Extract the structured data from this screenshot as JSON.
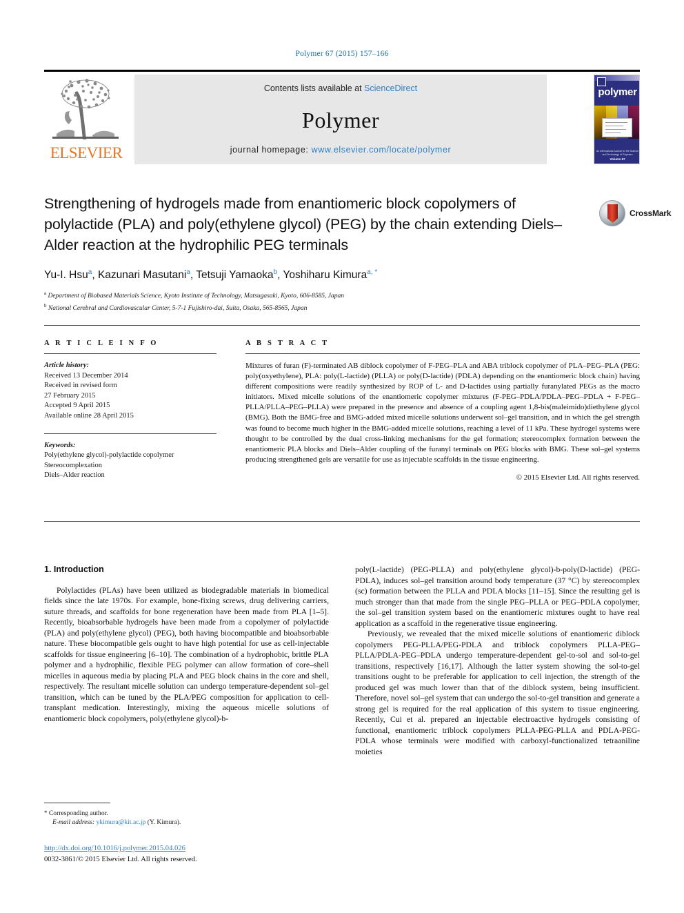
{
  "running_head": "Polymer 67 (2015) 157–166",
  "masthead": {
    "contents_prefix": "Contents lists available at ",
    "sciencedirect": "ScienceDirect",
    "journal_name": "Polymer",
    "homepage_prefix": "journal homepage: ",
    "homepage_url": "www.elsevier.com/locate/polymer",
    "publisher": "ELSEVIER",
    "cover_title": "polymer",
    "cover_footer_small": "An International Journal for the Science and Technology of Polymers",
    "cover_footer_bold": "Volume 67"
  },
  "crossmark": {
    "label": "CrossMark"
  },
  "title": "Strengthening of hydrogels made from enantiomeric block copolymers of polylactide (PLA) and poly(ethylene glycol) (PEG) by the chain extending Diels–Alder reaction at the hydrophilic PEG terminals",
  "authors": [
    {
      "name": "Yu-I. Hsu",
      "sup": "a"
    },
    {
      "name": "Kazunari Masutani",
      "sup": "a"
    },
    {
      "name": "Tetsuji Yamaoka",
      "sup": "b"
    },
    {
      "name": "Yoshiharu Kimura",
      "sup": "a, *"
    }
  ],
  "affiliations": [
    {
      "marker": "a",
      "text": "Department of Biobased Materials Science, Kyoto Institute of Technology, Matsugasaki, Kyoto, 606-8585, Japan"
    },
    {
      "marker": "b",
      "text": "National Cerebral and Cardiovascular Center, 5-7-1 Fujishiro-dai, Suita, Osaka, 565-8565, Japan"
    }
  ],
  "article_info": {
    "heading": "A R T I C L E   I N F O",
    "history_label": "Article history:",
    "history": [
      "Received 13 December 2014",
      "Received in revised form",
      "27 February 2015",
      "Accepted 9 April 2015",
      "Available online 28 April 2015"
    ],
    "keywords_label": "Keywords:",
    "keywords": [
      "Poly(ethylene glycol)-polylactide copolymer",
      "Stereocomplexation",
      "Diels–Alder reaction"
    ]
  },
  "abstract": {
    "heading": "A B S T R A C T",
    "text": "Mixtures of furan (F)-terminated AB diblock copolymer of F-PEG–PLA and ABA triblock copolymer of PLA–PEG–PLA (PEG: poly(oxyethylene), PLA: poly(L-lactide) (PLLA) or poly(D-lactide) (PDLA) depending on the enantiomeric block chain) having different compositions were readily synthesized by ROP of L- and D-lactides using partially furanylated PEGs as the macro initiators. Mixed micelle solutions of the enantiomeric copolymer mixtures (F-PEG–PDLA/PDLA–PEG–PDLA + F-PEG–PLLA/PLLA–PEG–PLLA) were prepared in the presence and absence of a coupling agent 1,8-bis(maleimido)diethylene glycol (BMG). Both the BMG-free and BMG-added mixed micelle solutions underwent sol–gel transition, and in which the gel strength was found to become much higher in the BMG-added micelle solutions, reaching a level of 11 kPa. These hydrogel systems were thought to be controlled by the dual cross-linking mechanisms for the gel formation; stereocomplex formation between the enantiomeric PLA blocks and Diels–Alder coupling of the furanyl terminals on PEG blocks with BMG. These sol–gel systems producing strengthened gels are versatile for use as injectable scaffolds in the tissue engineering.",
    "copyright": "© 2015 Elsevier Ltd. All rights reserved."
  },
  "body": {
    "section_heading": "1.  Introduction",
    "left_paragraphs": [
      "Polylactides (PLAs) have been utilized as biodegradable materials in biomedical fields since the late 1970s. For example, bone-fixing screws, drug delivering carriers, suture threads, and scaffolds for bone regeneration have been made from PLA [1–5]. Recently, bioabsorbable hydrogels have been made from a copolymer of polylactide (PLA) and poly(ethylene glycol) (PEG), both having biocompatible and bioabsorbable nature. These biocompatible gels ought to have high potential for use as cell-injectable scaffolds for tissue engineering [6–10]. The combination of a hydrophobic, brittle PLA polymer and a hydrophilic, flexible PEG polymer can allow formation of core–shell micelles in aqueous media by placing PLA and PEG block chains in the core and shell, respectively. The resultant micelle solution can undergo temperature-dependent sol–gel transition, which can be tuned by the PLA/PEG composition for application to cell-transplant medication. Interestingly, mixing the aqueous micelle solutions of enantiomeric block copolymers, poly(ethylene glycol)-b-"
    ],
    "right_paragraphs": [
      "poly(L-lactide) (PEG-PLLA) and poly(ethylene glycol)-b-poly(D-lactide) (PEG-PDLA), induces sol–gel transition around body temperature (37 °C) by stereocomplex (sc) formation between the PLLA and PDLA blocks [11–15]. Since the resulting gel is much stronger than that made from the single PEG–PLLA or PEG–PDLA copolymer, the sol–gel transition system based on the enantiomeric mixtures ought to have real application as a scaffold in the regenerative tissue engineering.",
      "Previously, we revealed that the mixed micelle solutions of enantiomeric diblock copolymers PEG-PLLA/PEG-PDLA and triblock copolymers PLLA-PEG–PLLA/PDLA-PEG–PDLA undergo temperature-dependent gel-to-sol and sol-to-gel transitions, respectively [16,17]. Although the latter system showing the sol-to-gel transitions ought to be preferable for application to cell injection, the strength of the produced gel was much lower than that of the diblock system, being insufficient. Therefore, novel sol–gel system that can undergo the sol-to-gel transition and generate a strong gel is required for the real application of this system to tissue engineering. Recently, Cui et al. prepared an injectable electroactive hydrogels consisting of functional, enantiomeric triblock copolymers PLLA-PEG-PLLA and PDLA-PEG-PDLA whose terminals were modified with carboxyl-functionalized tetraaniline moieties"
    ]
  },
  "footer": {
    "corresponding_star": "*",
    "corresponding_label": "Corresponding author.",
    "email_label": "E-mail address:",
    "email": "ykimura@kit.ac.jp",
    "email_owner": "(Y. Kimura).",
    "doi": "http://dx.doi.org/10.1016/j.polymer.2015.04.026",
    "issn_copyright": "0032-3861/© 2015 Elsevier Ltd. All rights reserved."
  },
  "colors": {
    "link_blue": "#2e7fc4",
    "elsevier_orange": "#E87722",
    "band_gray": "#e7e7e7",
    "cover_navy": "#2b2f7e"
  }
}
